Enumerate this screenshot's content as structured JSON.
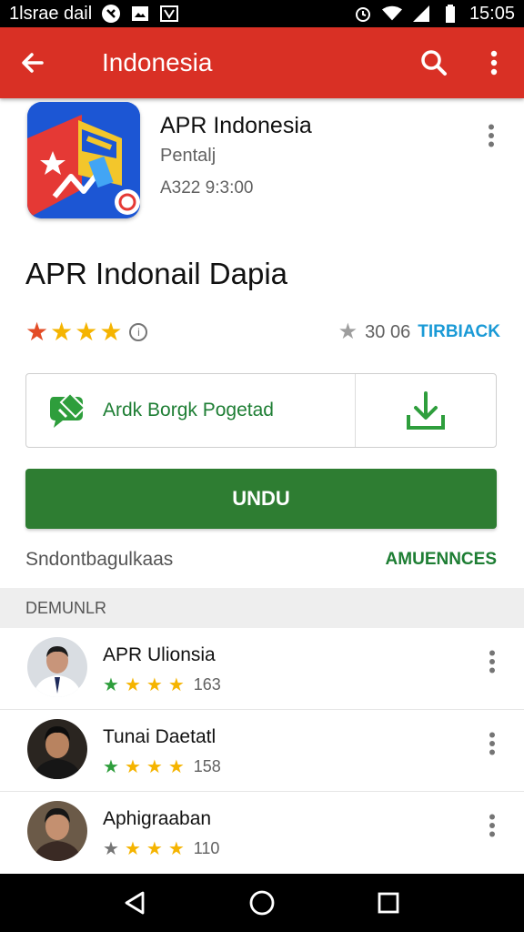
{
  "status_bar": {
    "carrier": "1lsrae dail",
    "time": "15:05"
  },
  "app_bar": {
    "title": "Indonesia"
  },
  "app": {
    "name": "APR Indonesia",
    "developer": "Pentalj",
    "meta": "A322 9:3:00"
  },
  "heading": "APR Indonail Dapia",
  "rating": {
    "stars": 4,
    "count": "30 06",
    "trailer": "TIRBIACK"
  },
  "action": {
    "label": "Ardk Borgk Pogetad"
  },
  "install": {
    "label": "UNDU"
  },
  "sub_row": {
    "left": "Sndontbagulkaas",
    "right": "AMUENNCES"
  },
  "section": {
    "title": "DEMUNLR"
  },
  "list": [
    {
      "name": "APR Ulionsia",
      "count": "163",
      "stars": 4,
      "first_star_color": "#2e9e3c"
    },
    {
      "name": "Tunai Daetatl",
      "count": "158",
      "stars": 4,
      "first_star_color": "#2e9e3c"
    },
    {
      "name": "Aphigraaban",
      "count": "110",
      "stars": 4,
      "first_star_color": "#757575"
    }
  ],
  "colors": {
    "app_bar": "#d93025",
    "install": "#2e7d32",
    "accent_green": "#1e7e34",
    "trailer_blue": "#1a9ad6",
    "star": "#f5b400"
  },
  "icons": [
    "back-arrow-icon",
    "search-icon",
    "more-vert-icon",
    "download-icon",
    "chat-icon",
    "info-icon",
    "star-icon",
    "back-nav-icon",
    "home-nav-icon",
    "recents-nav-icon"
  ]
}
